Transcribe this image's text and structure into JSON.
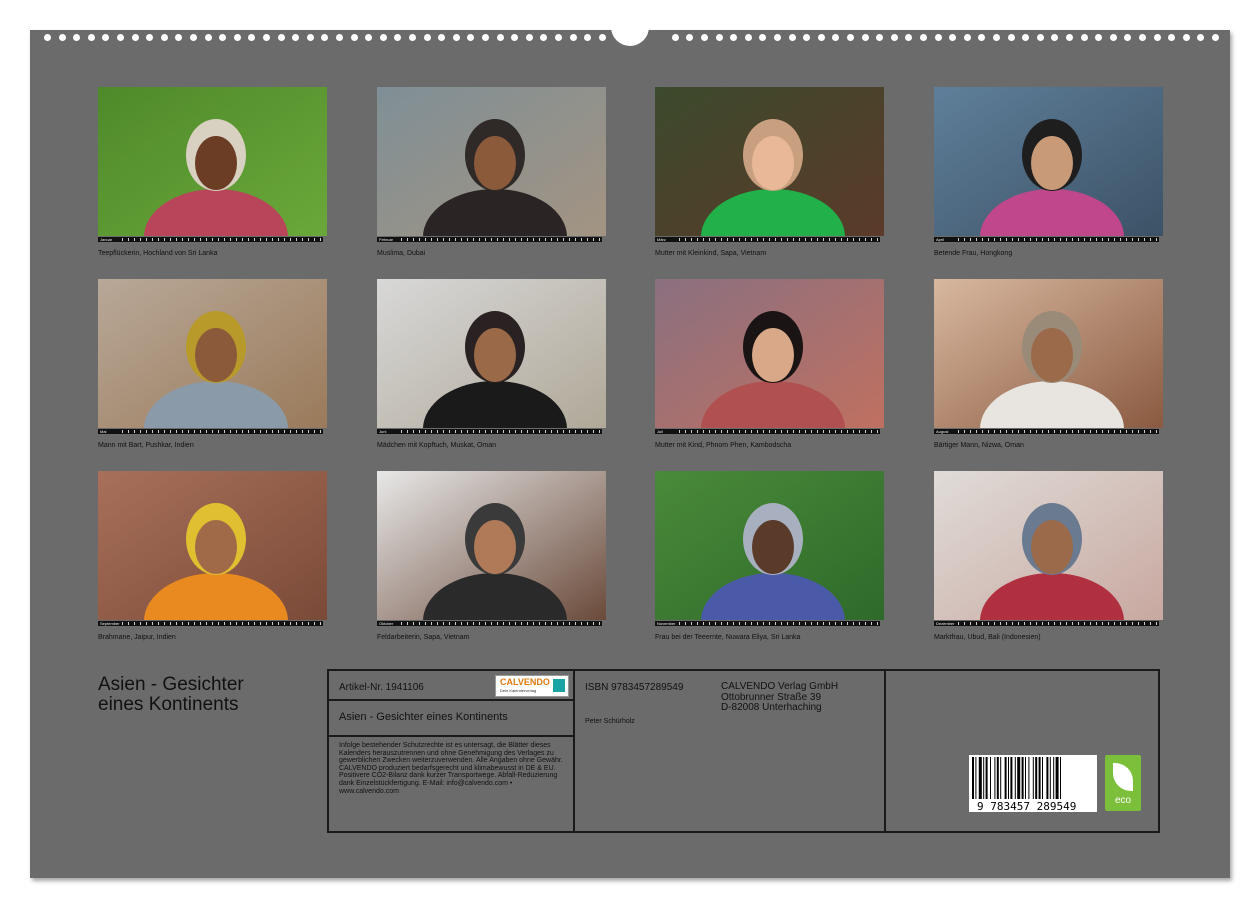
{
  "photos": [
    {
      "caption": "Teepflückerin, Hochland von Sri Lanka",
      "month": "Januar",
      "palette": {
        "bg": "#4f8a2a",
        "bg2": "#6aa83a",
        "figure": "#b8455a",
        "face": "#6b3d25",
        "head": "#d8d0c0"
      }
    },
    {
      "caption": "Muslima, Dubai",
      "month": "Februar",
      "palette": {
        "bg": "#7f8f96",
        "bg2": "#a39482",
        "figure": "#2a2524",
        "face": "#8a5a3a",
        "head": "#2f2a28"
      }
    },
    {
      "caption": "Mutter mit Kleinkind, Sapa, Vietnam",
      "month": "März",
      "palette": {
        "bg": "#3c4a2c",
        "bg2": "#5b3a2a",
        "figure": "#22b04a",
        "face": "#e8b898",
        "head": "#c8a080"
      }
    },
    {
      "caption": "Betende Frau, Hongkong",
      "month": "April",
      "palette": {
        "bg": "#5f7f9a",
        "bg2": "#3c5266",
        "figure": "#c0488a",
        "face": "#c89a78",
        "head": "#1e1e1e"
      }
    },
    {
      "caption": "Mann mit Bart, Pushkar, Indien",
      "month": "Mai",
      "palette": {
        "bg": "#b8a898",
        "bg2": "#9a7a5a",
        "figure": "#8a9aa8",
        "face": "#8a5a3a",
        "head": "#b89a2a"
      }
    },
    {
      "caption": "Mädchen mit Kopftuch, Muskat, Oman",
      "month": "Juni",
      "palette": {
        "bg": "#d8d8d8",
        "bg2": "#b0a898",
        "figure": "#1a1a1a",
        "face": "#9a6a48",
        "head": "#2a2222"
      }
    },
    {
      "caption": "Mutter mit Kind, Phnom Phen, Kambodscha",
      "month": "Juli",
      "palette": {
        "bg": "#8a7080",
        "bg2": "#c07060",
        "figure": "#b05050",
        "face": "#d8a888",
        "head": "#1a1414"
      }
    },
    {
      "caption": "Bärtiger Mann, Nizwa, Oman",
      "month": "August",
      "palette": {
        "bg": "#d8b8a0",
        "bg2": "#8a5a40",
        "figure": "#e8e4e0",
        "face": "#9a6a4a",
        "head": "#9a8a78"
      }
    },
    {
      "caption": "Brahmane, Jaipur, Indien",
      "month": "September",
      "palette": {
        "bg": "#a8705a",
        "bg2": "#7a4a38",
        "figure": "#e88a20",
        "face": "#a06a48",
        "head": "#e0c030"
      }
    },
    {
      "caption": "Feldarbeiterin, Sapa, Vietnam",
      "month": "Oktober",
      "palette": {
        "bg": "#e8e8e8",
        "bg2": "#6a4a3a",
        "figure": "#2a2a2a",
        "face": "#b07a58",
        "head": "#3a3a3a"
      }
    },
    {
      "caption": "Frau bei der Teeernte, Nuwara Eliya, Sri Lanka",
      "month": "November",
      "palette": {
        "bg": "#4a8a3a",
        "bg2": "#2e6a2a",
        "figure": "#4a5aa8",
        "face": "#5a3a28",
        "head": "#a8b0c0"
      }
    },
    {
      "caption": "Marktfrau, Ubud, Bali (Indonesien)",
      "month": "Dezember",
      "palette": {
        "bg": "#e0dcd8",
        "bg2": "#c8a8a0",
        "figure": "#b03040",
        "face": "#9a6a4a",
        "head": "#6a7a90"
      }
    }
  ],
  "title": {
    "line1": "Asien - Gesichter",
    "line2": "eines Kontinents"
  },
  "info": {
    "artikel": "Artikel-Nr. 1941106",
    "logo_text": "CALVENDO",
    "logo_sub": "Dein Kalenderverlag",
    "calendar_title": "Asien - Gesichter eines Kontinents",
    "legal": "Infolge bestehender Schutzrechte ist es untersagt, die Blätter dieses Kalenders herauszutrennen und ohne Genehmigung des Verlages zu gewerblichen Zwecken weiterzuverwenden. Alle Angaben ohne Gewähr. CALVENDO produziert bedarfsgerecht und klimabewusst in DE & EU. Positivere CO2-Bilanz dank kurzer Transportwege. Abfall-Reduzierung dank Einzelstückfertigung. E-Mail: info@calvendo.com • www.calvendo.com",
    "isbn": "ISBN 9783457289549",
    "author": "Peter Schürholz",
    "publisher1": "CALVENDO Verlag GmbH",
    "publisher2": "Ottobrunner Straße 39",
    "publisher3": "D-82008 Unterhaching",
    "barcode_number": "9 783457 289549",
    "eco_label": "eco"
  },
  "colors": {
    "page": "#6b6b6b",
    "border": "#1a1a1a",
    "eco": "#7bbf3a",
    "logo_accent": "#e07a10"
  }
}
